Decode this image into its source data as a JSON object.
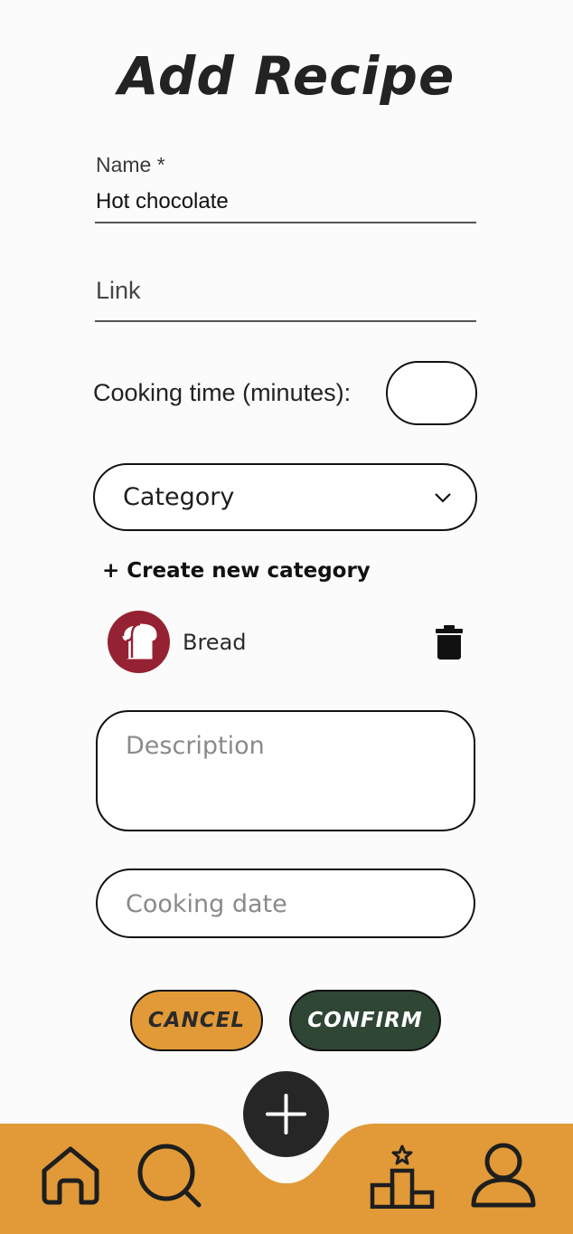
{
  "header": {
    "title": "Add Recipe"
  },
  "form": {
    "name_label": "Name *",
    "name_value": "Hot chocolate",
    "link_label": "Link",
    "cooking_time_label": "Cooking time (minutes):",
    "cooking_time_value": "",
    "category_select": "Category",
    "create_category": "+ Create new category",
    "categories": [
      {
        "name": "Bread",
        "icon": "bread-icon",
        "color": "#952232"
      }
    ],
    "description_placeholder": "Description",
    "cooking_date_placeholder": "Cooking date"
  },
  "actions": {
    "cancel_label": "CANCEL",
    "confirm_label": "CONFIRM",
    "cancel_color": "#E19A37",
    "confirm_color": "#2F4634"
  },
  "nav": {
    "bar_color": "#E19A37",
    "items": [
      {
        "icon": "home-icon"
      },
      {
        "icon": "search-icon"
      },
      {
        "icon": "add-icon"
      },
      {
        "icon": "ranking-icon"
      },
      {
        "icon": "profile-icon"
      }
    ]
  }
}
